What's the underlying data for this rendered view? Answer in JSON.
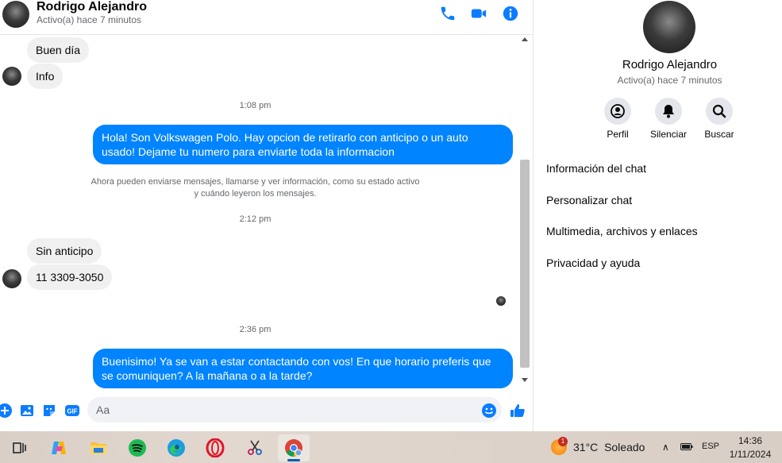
{
  "contact": {
    "name": "Rodrigo Alejandro",
    "status": "Activo(a) hace 7 minutos"
  },
  "messages": [
    {
      "type": "in",
      "text": "Buen día"
    },
    {
      "type": "in",
      "text": "Info"
    },
    {
      "type": "time",
      "text": "1:08 pm"
    },
    {
      "type": "out",
      "text": "Hola! Son Volkswagen Polo. Hay opcion de retirarlo con anticipo o un auto usado! Dejame tu numero para enviarte toda la informacion"
    },
    {
      "type": "system",
      "line1": "Ahora pueden enviarse mensajes, llamarse y ver información, como su estado activo",
      "line2": "y cuándo leyeron los mensajes."
    },
    {
      "type": "time",
      "text": "2:12 pm"
    },
    {
      "type": "in",
      "text": "Sin anticipo"
    },
    {
      "type": "in",
      "text": "11 3309-3050"
    },
    {
      "type": "time",
      "text": "2:36 pm"
    },
    {
      "type": "out",
      "text": "Buenisimo! Ya se van a estar contactando con vos! En que horario preferis que se comuniquen? A la mañana o a la tarde?"
    }
  ],
  "composer": {
    "placeholder": "Aa",
    "gif_label": "GIF"
  },
  "side": {
    "actions": [
      {
        "label": "Perfil",
        "icon": "profile-icon"
      },
      {
        "label": "Silenciar",
        "icon": "bell-icon"
      },
      {
        "label": "Buscar",
        "icon": "search-icon"
      }
    ],
    "menu": [
      "Información del chat",
      "Personalizar chat",
      "Multimedia, archivos y enlaces",
      "Privacidad y ayuda"
    ]
  },
  "taskbar": {
    "apps": [
      "task-view",
      "copilot",
      "file-explorer",
      "spotify",
      "edge",
      "opera",
      "snipping-tool",
      "chrome"
    ],
    "weather": {
      "temp": "31°C",
      "condition": "Soleado",
      "badge": "1"
    },
    "language": "ESP",
    "time": "14:36",
    "date": "1/11/2024"
  },
  "colors": {
    "accent": "#0084ff",
    "header_icons": "#0a7cff",
    "incoming_bubble": "#f0f0f0"
  }
}
